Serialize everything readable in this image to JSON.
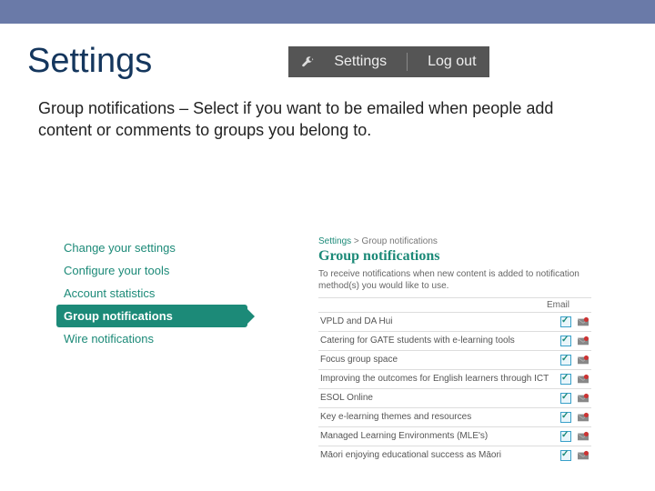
{
  "header": {
    "title": "Settings",
    "settings_label": "Settings",
    "logout_label": "Log out"
  },
  "description": "Group notifications – Select if you want to be emailed when people add content or comments to groups you belong to.",
  "sidebar": {
    "items": [
      {
        "label": "Change your settings",
        "active": false
      },
      {
        "label": "Configure your tools",
        "active": false
      },
      {
        "label": "Account statistics",
        "active": false
      },
      {
        "label": "Group notifications",
        "active": true
      },
      {
        "label": "Wire notifications",
        "active": false
      }
    ]
  },
  "panel": {
    "breadcrumb_root": "Settings",
    "breadcrumb_sep": " > ",
    "breadcrumb_leaf": "Group notifications",
    "title": "Group notifications",
    "description": "To receive notifications when new content is added to notification method(s) you would like to use.",
    "column": "Email",
    "groups": [
      {
        "label": "VPLD and DA Hui",
        "email": true
      },
      {
        "label": "Catering for GATE students with e-learning tools",
        "email": true
      },
      {
        "label": "Focus group space",
        "email": true
      },
      {
        "label": "Improving the outcomes for English learners through ICT",
        "email": true
      },
      {
        "label": "ESOL Online",
        "email": true
      },
      {
        "label": "Key e-learning themes and resources",
        "email": true
      },
      {
        "label": "Managed Learning Environments (MLE's)",
        "email": true
      },
      {
        "label": "Māori enjoying educational success as Māori",
        "email": true
      }
    ]
  }
}
